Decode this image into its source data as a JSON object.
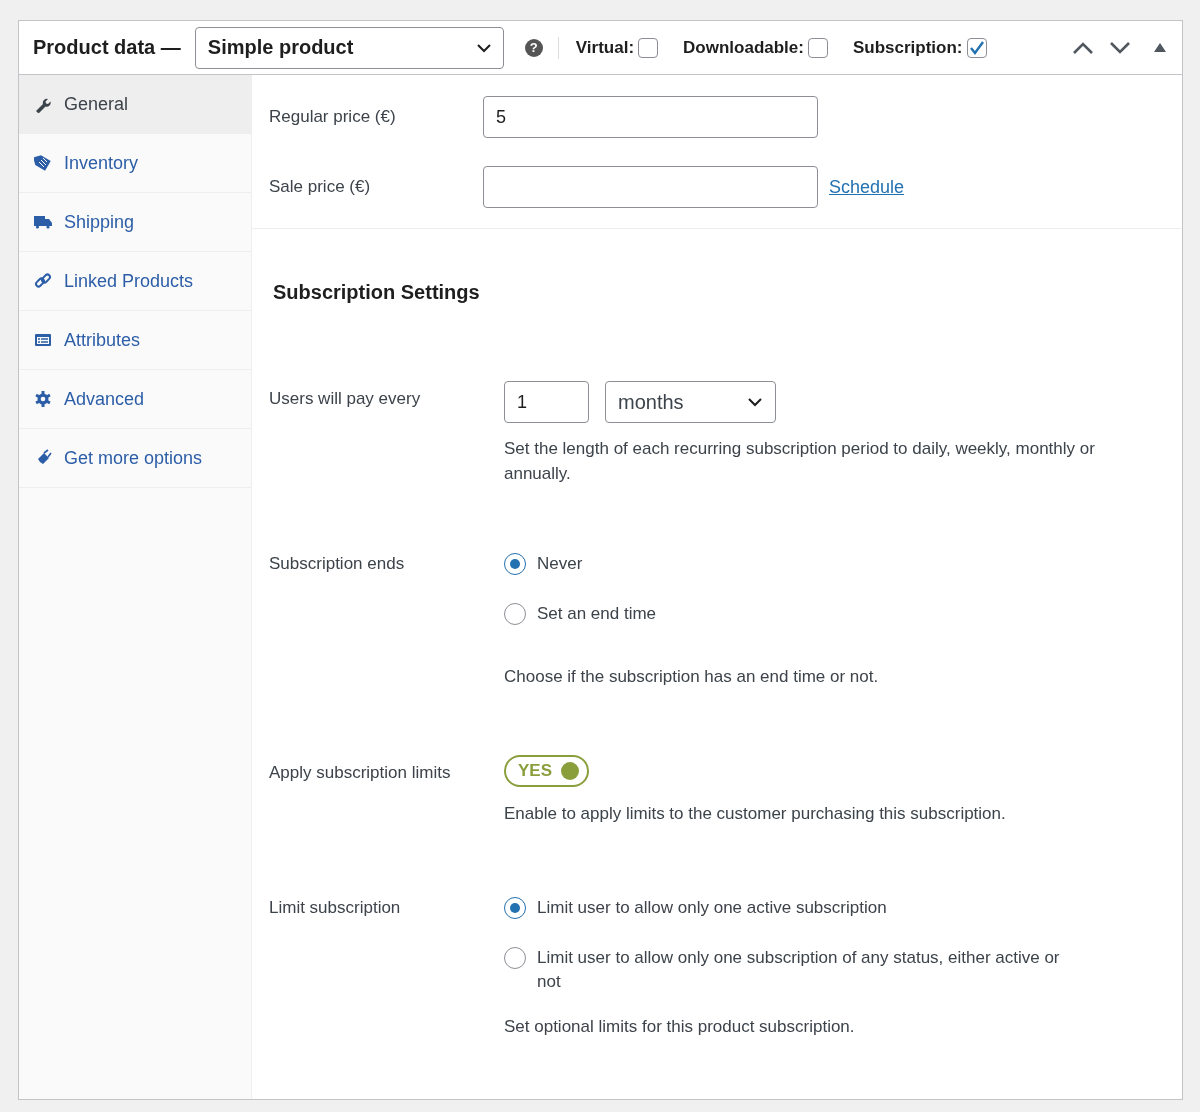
{
  "header": {
    "title": "Product data —",
    "product_type": "Simple product",
    "help": "?",
    "options": [
      {
        "label": "Virtual:",
        "checked": false
      },
      {
        "label": "Downloadable:",
        "checked": false
      },
      {
        "label": "Subscription:",
        "checked": true
      }
    ]
  },
  "tabs": [
    {
      "label": "General",
      "kind": "wrench",
      "selected": true
    },
    {
      "label": "Inventory",
      "kind": "tag",
      "selected": false
    },
    {
      "label": "Shipping",
      "kind": "truck",
      "selected": false
    },
    {
      "label": "Linked Products",
      "kind": "link",
      "selected": false
    },
    {
      "label": "Attributes",
      "kind": "list",
      "selected": false
    },
    {
      "label": "Advanced",
      "kind": "gear",
      "selected": false
    },
    {
      "label": "Get more options",
      "kind": "plug",
      "selected": false
    }
  ],
  "pricing": [
    {
      "label": "Regular price (€)",
      "value": "5"
    },
    {
      "label": "Sale price (€)",
      "link": "Schedule"
    }
  ],
  "subscription": {
    "heading": "Subscription Settings",
    "rows": [
      {
        "kind": "period",
        "label": "Users will pay every",
        "interval": "1",
        "period": "months",
        "description": "Set the length of each recurring subscription period to daily, weekly, monthly or annually."
      },
      {
        "kind": "radio",
        "label": "Subscription ends",
        "options": [
          {
            "label": "Never",
            "selected": true
          },
          {
            "label": "Set an end time",
            "selected": false
          }
        ],
        "description": "Choose if the subscription has an end time or not."
      },
      {
        "kind": "toggle",
        "label": "Apply subscription limits",
        "toggle": {
          "label": "YES",
          "on": true
        },
        "description": "Enable to apply limits to the customer purchasing this subscription."
      },
      {
        "kind": "radio",
        "label": "Limit subscription",
        "options": [
          {
            "label": "Limit user to allow only one active subscription",
            "selected": true
          },
          {
            "label": "Limit user to allow only one subscription of any status, either active or not",
            "selected": false
          }
        ],
        "description": "Set optional limits for this product subscription."
      }
    ]
  }
}
